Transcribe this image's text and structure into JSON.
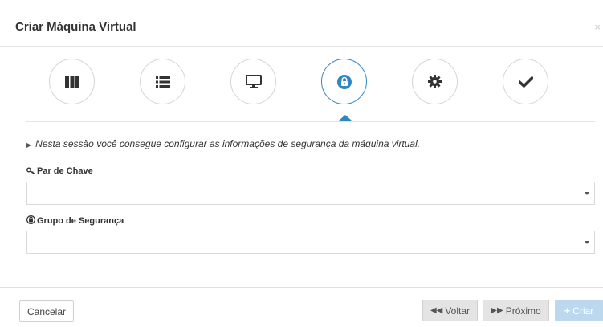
{
  "header": {
    "title": "Criar Máquina Virtual",
    "close_symbol": "×"
  },
  "steps": [
    {
      "name": "template",
      "icon": "grid-icon"
    },
    {
      "name": "list",
      "icon": "list-icon"
    },
    {
      "name": "monitor",
      "icon": "monitor-icon"
    },
    {
      "name": "security",
      "icon": "lock-icon",
      "active": true
    },
    {
      "name": "settings",
      "icon": "gear-icon"
    },
    {
      "name": "confirm",
      "icon": "check-icon"
    }
  ],
  "main": {
    "info_text": "Nesta sessão você consegue configurar as informações de segurança da máquina virtual.",
    "key_pair_label": "Par de Chave",
    "key_pair_value": "",
    "security_group_label": "Grupo de Segurança",
    "security_group_value": ""
  },
  "footer": {
    "cancel_label": "Cancelar",
    "back_label": "Voltar",
    "next_label": "Próximo",
    "create_label": "Criar"
  },
  "colors": {
    "accent": "#2f86c5",
    "create_disabled": "#bcd8ee"
  }
}
